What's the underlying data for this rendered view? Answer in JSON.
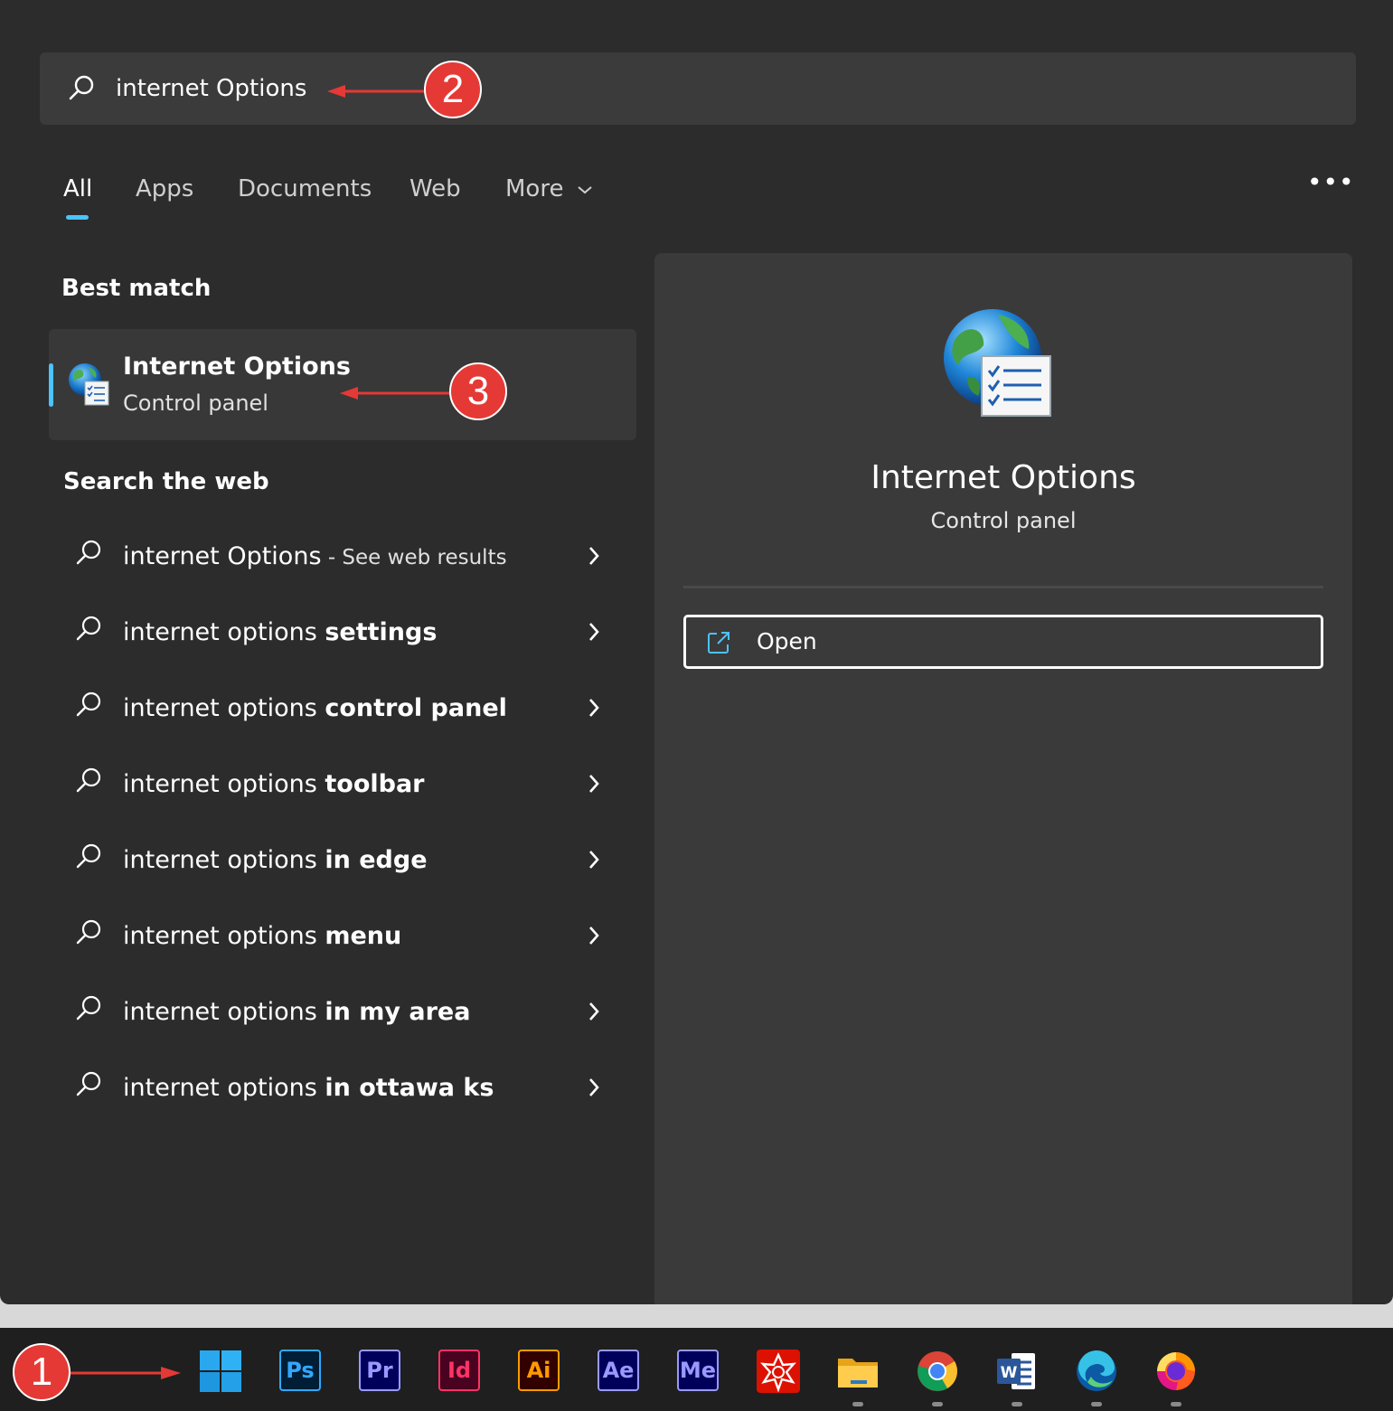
{
  "search": {
    "query": "internet Options"
  },
  "tabs": [
    {
      "label": "All"
    },
    {
      "label": "Apps"
    },
    {
      "label": "Documents"
    },
    {
      "label": "Web"
    },
    {
      "label": "More"
    }
  ],
  "best_match": {
    "heading": "Best match",
    "title": "Internet Options",
    "subtitle": "Control panel"
  },
  "web": {
    "heading": "Search the web",
    "first": {
      "plain": "internet Options",
      "suffix": " - See web results"
    },
    "items": [
      {
        "plain": "internet options ",
        "bold": "settings"
      },
      {
        "plain": "internet options ",
        "bold": "control panel"
      },
      {
        "plain": "internet options ",
        "bold": "toolbar"
      },
      {
        "plain": "internet options ",
        "bold": "in edge"
      },
      {
        "plain": "internet options ",
        "bold": "menu"
      },
      {
        "plain": "internet options ",
        "bold": "in my area"
      },
      {
        "plain": "internet options ",
        "bold": "in ottawa ks"
      }
    ]
  },
  "preview": {
    "title": "Internet Options",
    "subtitle": "Control panel",
    "open_label": "Open"
  },
  "taskbar": [
    {
      "name": "start-button",
      "text": ""
    },
    {
      "name": "photoshop-icon",
      "text": "Ps",
      "fg": "#31a8ff",
      "bg": "#001e36"
    },
    {
      "name": "premiere-icon",
      "text": "Pr",
      "fg": "#9999ff",
      "bg": "#00005b"
    },
    {
      "name": "indesign-icon",
      "text": "Id",
      "fg": "#ff3366",
      "bg": "#49021f"
    },
    {
      "name": "illustrator-icon",
      "text": "Ai",
      "fg": "#ff9a00",
      "bg": "#330000"
    },
    {
      "name": "after-effects-icon",
      "text": "Ae",
      "fg": "#9999ff",
      "bg": "#00005b"
    },
    {
      "name": "media-encoder-icon",
      "text": "Me",
      "fg": "#9999ff",
      "bg": "#00005b"
    },
    {
      "name": "wolfram-icon",
      "text": ""
    },
    {
      "name": "file-explorer-icon",
      "text": ""
    },
    {
      "name": "chrome-icon",
      "text": ""
    },
    {
      "name": "word-icon",
      "text": "W"
    },
    {
      "name": "edge-icon",
      "text": ""
    },
    {
      "name": "firefox-icon",
      "text": ""
    }
  ],
  "annotations": [
    "1",
    "2",
    "3"
  ],
  "colors": {
    "accent": "#4cc2ff",
    "badge": "#e53935"
  }
}
